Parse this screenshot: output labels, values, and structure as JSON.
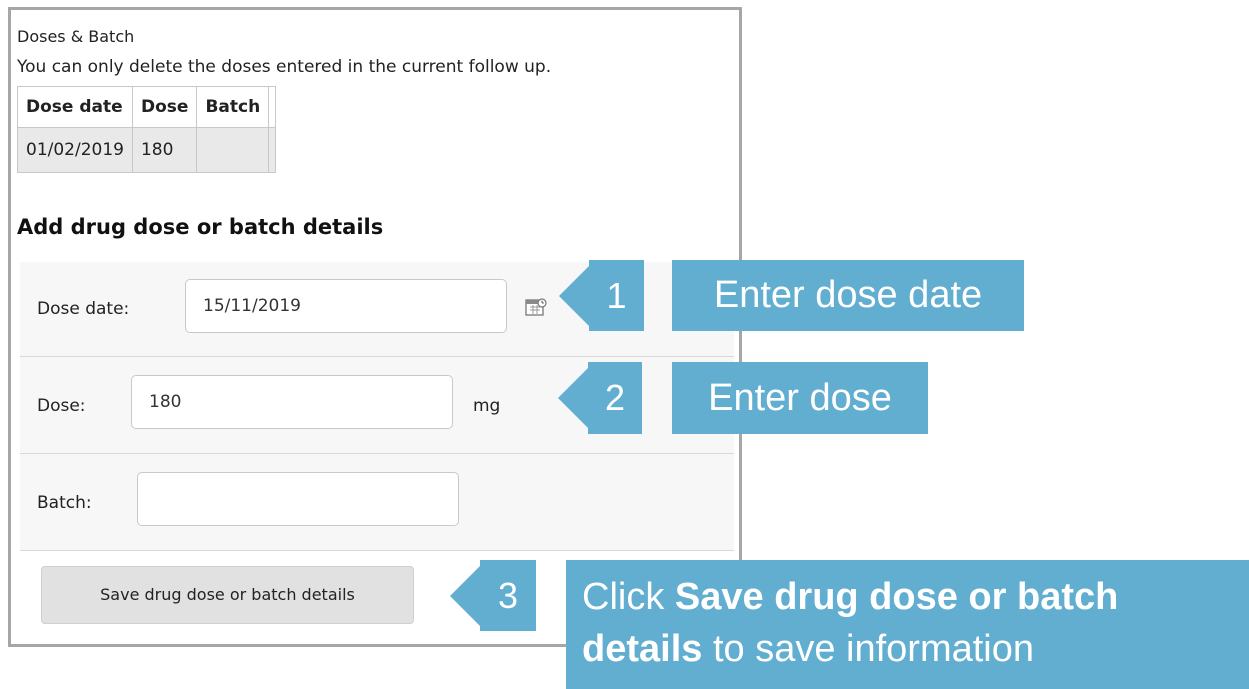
{
  "doses_section": {
    "heading": "Doses & Batch",
    "note": "You can only delete the doses entered in the current follow up.",
    "columns": [
      "Dose date",
      "Dose",
      "Batch",
      ""
    ],
    "rows": [
      [
        "01/02/2019",
        "180",
        "",
        ""
      ]
    ]
  },
  "add_section": {
    "title": "Add drug dose or batch details",
    "dose_date": {
      "label": "Dose date:",
      "value": "15/11/2019"
    },
    "dose": {
      "label": "Dose:",
      "value": "180",
      "unit": "mg"
    },
    "batch": {
      "label": "Batch:",
      "value": ""
    },
    "save_label": "Save drug dose or batch details"
  },
  "callouts": [
    {
      "number": "1",
      "text": "Enter dose date"
    },
    {
      "number": "2",
      "text": "Enter dose"
    },
    {
      "number": "3",
      "text_prefix": "Click ",
      "text_bold": "Save drug dose or batch details",
      "text_suffix": " to save information"
    }
  ],
  "colors": {
    "callout": "#62aed1",
    "panel_border": "#a6a6a6"
  }
}
